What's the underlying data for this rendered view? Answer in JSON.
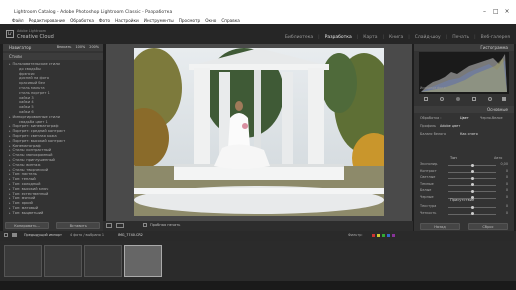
{
  "window": {
    "title": "Lightroom Catalog - Adobe Photoshop Lightroom Classic - Разработка"
  },
  "menu": [
    "Файл",
    "Редактирование",
    "Обработка",
    "Фото",
    "Настройки",
    "Инструменты",
    "Просмотр",
    "Окно",
    "Справка"
  ],
  "identity": {
    "logo": "Lr",
    "name": "Adobe Lightroom",
    "subtitle": "Creative Cloud"
  },
  "modules": [
    "Библиотека",
    "Разработка",
    "Карта",
    "Книга",
    "Слайд-шоу",
    "Печать",
    "Веб-галерея"
  ],
  "modules_active_index": 1,
  "left_panel": {
    "navigator": {
      "label": "Навигатор",
      "zoom_fit": "Вписать",
      "zoom_100": "100%",
      "zoom_200": "200%"
    },
    "presets_header": "Стили",
    "presets": [
      {
        "label": "Пользовательские стили",
        "top": true
      },
      {
        "label": "до свадьбы",
        "top": false
      },
      {
        "label": "фрэнсис",
        "top": false
      },
      {
        "label": "дисней на фото",
        "top": false
      },
      {
        "label": "красивый бел",
        "top": false
      },
      {
        "label": "стиль мальта",
        "top": false
      },
      {
        "label": "стиль портрет 1",
        "top": false
      },
      {
        "label": "хайки 3",
        "top": false
      },
      {
        "label": "хайки 4",
        "top": false
      },
      {
        "label": "хайки 5",
        "top": false
      },
      {
        "label": "хайки 6",
        "top": false
      },
      {
        "label": "Импортированные стили",
        "top": true
      },
      {
        "label": "свадьба цвет 1",
        "top": false
      },
      {
        "label": "Портрет: кинематограф",
        "top": true
      },
      {
        "label": "Портрет: средний контраст",
        "top": true
      },
      {
        "label": "Портрет: светлая кожа",
        "top": true
      },
      {
        "label": "Портрет: высокий контраст",
        "top": true
      },
      {
        "label": "Кинематограф",
        "top": true
      },
      {
        "label": "Стиль: контрастный",
        "top": true
      },
      {
        "label": "Стиль: монохромный",
        "top": true
      },
      {
        "label": "Стиль: приглушенный",
        "top": true
      },
      {
        "label": "Стиль: винтаж",
        "top": true
      },
      {
        "label": "Стиль: творческий",
        "top": true
      },
      {
        "label": "Тон: пастель",
        "top": true
      },
      {
        "label": "Тон: теплый",
        "top": true
      },
      {
        "label": "Тон: холодный",
        "top": true
      },
      {
        "label": "Тон: высокий ключ",
        "top": true
      },
      {
        "label": "Тон: естественный",
        "top": true
      },
      {
        "label": "Тон: мягкий",
        "top": true
      },
      {
        "label": "Тон: яркий",
        "top": true
      },
      {
        "label": "Тон: матовый",
        "top": true
      },
      {
        "label": "Тон: выцветший",
        "top": true
      }
    ],
    "copy_btn": "Копировать...",
    "paste_btn": "Вставить"
  },
  "toolbar": {
    "softproof": "Пробная печать",
    "view_icon": "grid-icon"
  },
  "right_panel": {
    "histogram_label": "Гистограмма",
    "photo_label": "Исходное фото",
    "basic_header": "Основные",
    "treatment": "Обработка :",
    "color": "Цвет",
    "bw": "Черно-белое",
    "profile_label": "Профиль",
    "profile_value": "Adobe цвет",
    "wb_label": "Баланс белого",
    "wb_value": "Как снято",
    "tone_label": "Тон",
    "tone_auto": "Авто",
    "sliders": [
      {
        "label": "Экспонир.",
        "value": "0,00",
        "pos": 0.5
      },
      {
        "label": "Контраст",
        "value": "0",
        "pos": 0.5
      },
      {
        "label": "Светлые",
        "value": "0",
        "pos": 0.5
      },
      {
        "label": "Темные",
        "value": "0",
        "pos": 0.5
      },
      {
        "label": "Белые",
        "value": "0",
        "pos": 0.5
      },
      {
        "label": "Черные",
        "value": "0",
        "pos": 0.5
      }
    ],
    "presence_label": "Присутствие",
    "presence_sliders": [
      {
        "label": "Текстура",
        "value": "0",
        "pos": 0.5
      },
      {
        "label": "Четкость",
        "value": "0",
        "pos": 0.5
      }
    ],
    "prev_btn": "Назад",
    "reset_btn": "Сброс"
  },
  "filmstrip_bar": {
    "source": "Предыдущий импорт",
    "count": "4 фото / выбрано 1",
    "filename": "IMG_7740.CR2",
    "filter_label": "Фильтр:"
  },
  "filmstrip": {
    "thumb_count": 4,
    "selected_index": 3
  }
}
